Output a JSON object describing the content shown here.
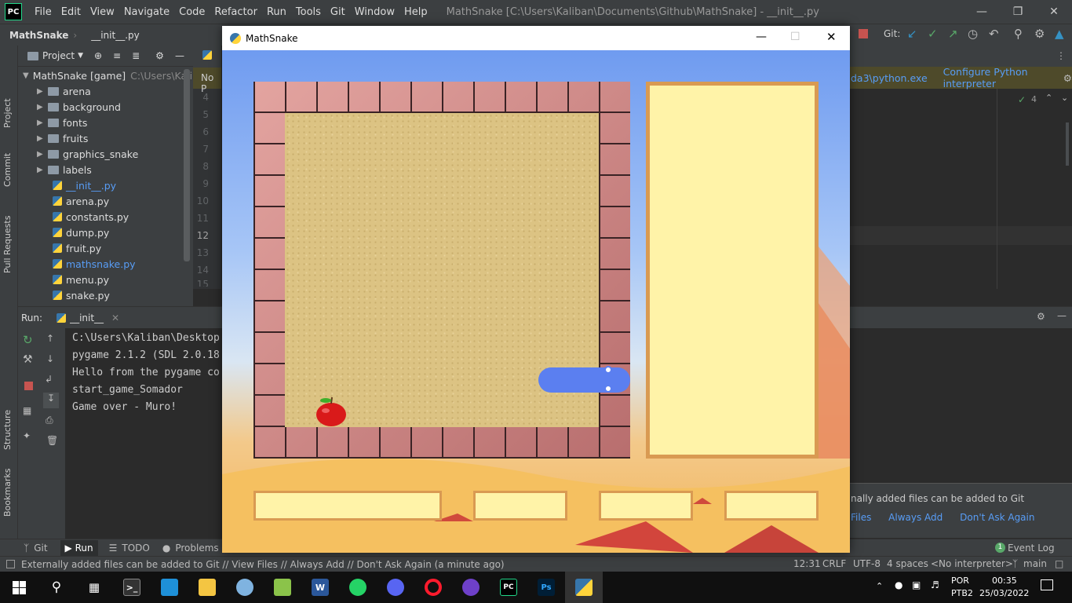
{
  "ide": {
    "logo": "PC",
    "menu": [
      "File",
      "Edit",
      "View",
      "Navigate",
      "Code",
      "Refactor",
      "Run",
      "Tools",
      "Git",
      "Window",
      "Help"
    ],
    "window_title": "MathSnake [C:\\Users\\Kaliban\\Documents\\Github\\MathSnake] - __init__.py",
    "nav": {
      "project": "MathSnake",
      "file": "__init__.py"
    },
    "git_label": "Git:",
    "left_tabs": [
      "Project",
      "Commit",
      "Pull Requests",
      "Structure",
      "Bookmarks"
    ],
    "project_panel": {
      "title": "Project",
      "root": "MathSnake [game]",
      "root_path": "C:\\Users\\Kaliban",
      "folders": [
        "arena",
        "background",
        "fonts",
        "fruits",
        "graphics_snake",
        "labels"
      ],
      "files": [
        "__init__.py",
        "arena.py",
        "constants.py",
        "dump.py",
        "fruit.py",
        "mathsnake.py",
        "menu.py",
        "snake.py"
      ]
    },
    "editor": {
      "tab_partial": "No P",
      "line_numbers": [
        "4",
        "5",
        "6",
        "7",
        "8",
        "9",
        "10",
        "11",
        "12",
        "13",
        "14",
        "15"
      ],
      "interpreter_path": "da3\\python.exe",
      "configure_link": "Configure Python interpreter",
      "inspection_count": "4"
    },
    "run_panel": {
      "label": "Run:",
      "config": "__init__",
      "console": [
        "C:\\Users\\Kaliban\\Desktop",
        "pygame 2.1.2 (SDL 2.0.18",
        "Hello from the pygame co",
        "start_game_Somador",
        "Game over - Muro!"
      ]
    },
    "notification": {
      "text": "nally added files can be added to Git",
      "links": [
        "Files",
        "Always Add",
        "Don't Ask Again"
      ]
    },
    "bottom_tabs": [
      "Git",
      "Run",
      "TODO",
      "Problems"
    ],
    "event_log": {
      "count": "1",
      "label": "Event Log"
    },
    "status": {
      "message": "Externally added files can be added to Git // View Files // Always Add // Don't Ask Again (a minute ago)",
      "position": "12:31",
      "line_sep": "CRLF",
      "encoding": "UTF-8",
      "indent": "4 spaces",
      "interpreter": "<No interpreter>",
      "branch": "main"
    }
  },
  "game": {
    "title": "MathSnake",
    "answer_boxes": 4,
    "colors": {
      "snake": "#5b7ff0",
      "panel": "#fff3a8",
      "panel_border": "#d99a52",
      "sand": "#dcc383"
    }
  },
  "taskbar": {
    "lang": "POR",
    "layout": "PTB2",
    "time": "00:35",
    "date": "25/03/2022"
  }
}
